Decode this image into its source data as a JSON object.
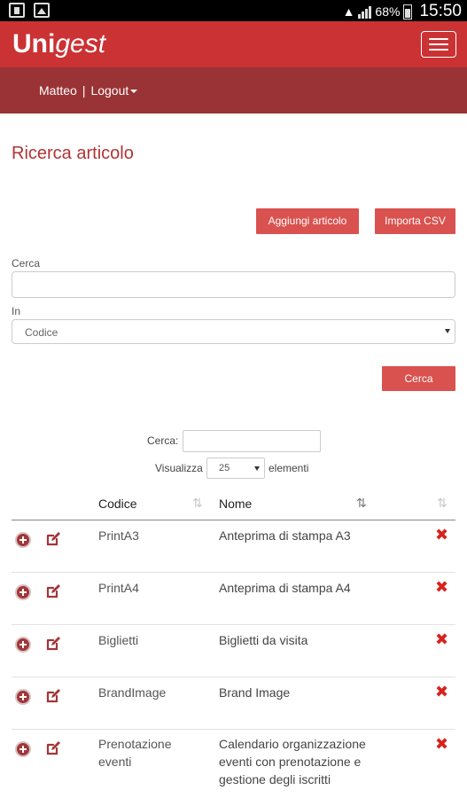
{
  "statusbar": {
    "icons_left": [
      "phone-icon",
      "gallery-icon"
    ],
    "battery": "68%",
    "time": "15:50"
  },
  "header": {
    "brand_bold": "Uni",
    "brand_italic": "gest",
    "menu_icon": "hamburger-icon"
  },
  "userbar": {
    "user": "Matteo",
    "separator": "|",
    "logout": "Logout"
  },
  "page": {
    "title": "Ricerca articolo",
    "add_button": "Aggiungi articolo",
    "import_button": "Importa CSV",
    "search_label": "Cerca",
    "search_value": "",
    "in_label": "In",
    "in_value": "Codice",
    "search_button": "Cerca"
  },
  "datatable": {
    "filter_label": "Cerca:",
    "filter_value": "",
    "length_prefix": "Visualizza",
    "length_value": "25",
    "length_suffix": "elementi",
    "columns": [
      "Codice",
      "Nome"
    ],
    "rows": [
      {
        "code": "PrintA3",
        "name": "Anteprima di stampa A3"
      },
      {
        "code": "PrintA4",
        "name": "Anteprima di stampa A4"
      },
      {
        "code": "Biglietti",
        "name": "Biglietti da visita"
      },
      {
        "code": "BrandImage",
        "name": "Brand Image"
      },
      {
        "code": "Prenotazione eventi",
        "name": "Calendario organizzazione eventi con prenotazione e gestione degli iscritti"
      }
    ]
  },
  "colors": {
    "navbar": "#cb3234",
    "userbar": "#9a3335",
    "button": "#d9524f",
    "title": "#b13335",
    "delete": "#d8221c"
  }
}
